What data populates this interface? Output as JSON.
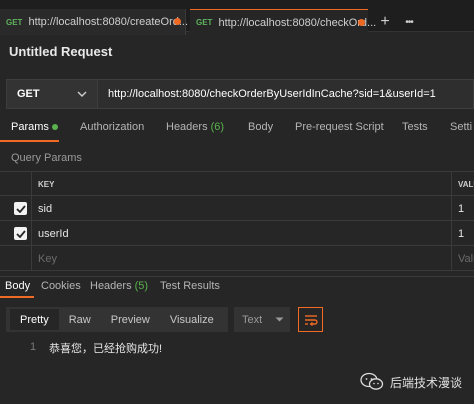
{
  "tabs": [
    {
      "method": "GET",
      "label": "http://localhost:8080/createOrd..."
    },
    {
      "method": "GET",
      "label": "http://localhost:8080/checkOrd..."
    }
  ],
  "tab_actions": {
    "add": "+",
    "more": "•••"
  },
  "request_title": "Untitled Request",
  "method": "GET",
  "url": "http://localhost:8080/checkOrderByUserIdInCache?sid=1&userId=1",
  "request_tabs": {
    "params": "Params",
    "authorization": "Authorization",
    "headers": "Headers",
    "headers_count": "(6)",
    "body": "Body",
    "prerequest": "Pre-request Script",
    "tests": "Tests",
    "settings": "Setti"
  },
  "query_params_label": "Query Params",
  "params_table": {
    "col_key": "KEY",
    "col_value": "VALU",
    "rows": [
      {
        "key": "sid",
        "value": "1",
        "checked": true
      },
      {
        "key": "userId",
        "value": "1",
        "checked": true
      }
    ],
    "placeholder": {
      "key": "Key",
      "value": "Valu"
    }
  },
  "response_tabs": {
    "body": "Body",
    "cookies": "Cookies",
    "headers": "Headers",
    "headers_count": "(5)",
    "test_results": "Test Results"
  },
  "response_toolbar": {
    "pretty": "Pretty",
    "raw": "Raw",
    "preview": "Preview",
    "visualize": "Visualize",
    "format": "Text"
  },
  "response_body": {
    "line": "1",
    "text": "恭喜您，已经抢购成功!"
  },
  "watermark": "后端技术漫谈",
  "colors": {
    "accent": "#f06a24",
    "get_method": "#5fb35f",
    "green_badge": "#59b34c"
  }
}
